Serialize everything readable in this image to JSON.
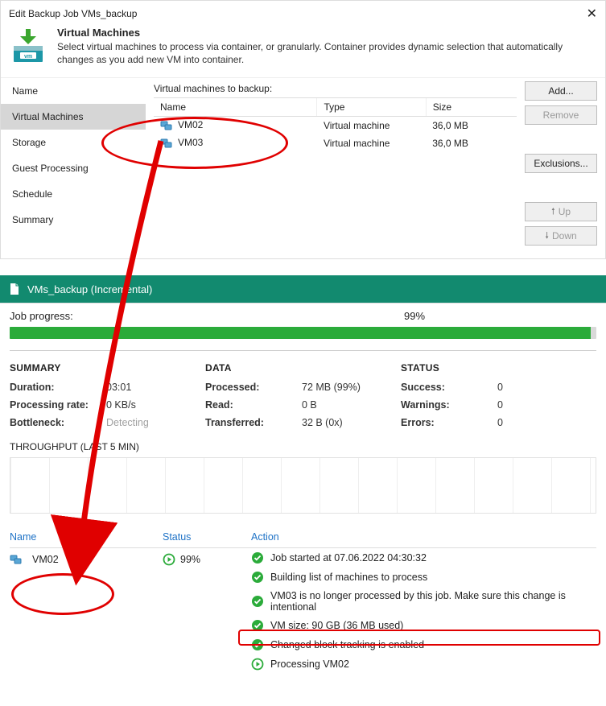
{
  "dialog": {
    "title": "Edit Backup Job VMs_backup",
    "banner": {
      "heading": "Virtual Machines",
      "desc": "Select virtual machines to process via container, or granularly. Container provides dynamic selection that automatically changes as you add new VM into container."
    },
    "sidebar": [
      {
        "label": "Name",
        "selected": false
      },
      {
        "label": "Virtual Machines",
        "selected": true
      },
      {
        "label": "Storage",
        "selected": false
      },
      {
        "label": "Guest Processing",
        "selected": false
      },
      {
        "label": "Schedule",
        "selected": false
      },
      {
        "label": "Summary",
        "selected": false
      }
    ],
    "section_label": "Virtual machines to backup:",
    "columns": [
      "Name",
      "Type",
      "Size"
    ],
    "rows": [
      {
        "name": "VM02",
        "type": "Virtual machine",
        "size": "36,0 MB"
      },
      {
        "name": "VM03",
        "type": "Virtual machine",
        "size": "36,0 MB"
      }
    ],
    "buttons": {
      "add": "Add...",
      "remove": "Remove",
      "exclusions": "Exclusions...",
      "up": "Up",
      "down": "Down"
    }
  },
  "job": {
    "title": "VMs_backup (Incremental)",
    "progress_label": "Job progress:",
    "progress_value": "99%",
    "progress_percent": 99,
    "summary": {
      "head": "SUMMARY",
      "duration_k": "Duration:",
      "duration_v": "03:01",
      "rate_k": "Processing rate:",
      "rate_v": "0 KB/s",
      "bottleneck_k": "Bottleneck:",
      "bottleneck_v": "Detecting"
    },
    "data": {
      "head": "DATA",
      "processed_k": "Processed:",
      "processed_v": "72 MB (99%)",
      "read_k": "Read:",
      "read_v": "0 B",
      "transferred_k": "Transferred:",
      "transferred_v": "32 B (0x)"
    },
    "status": {
      "head": "STATUS",
      "success_k": "Success:",
      "success_v": "0",
      "warnings_k": "Warnings:",
      "warnings_v": "0",
      "errors_k": "Errors:",
      "errors_v": "0"
    },
    "throughput_label": "THROUGHPUT (LAST 5 MIN)",
    "lower": {
      "name_head": "Name",
      "status_head": "Status",
      "action_head": "Action",
      "vm_name": "VM02",
      "vm_status": "99%",
      "actions": [
        "Job started at 07.06.2022 04:30:32",
        "Building list of machines to process",
        "VM03 is no longer processed by this job. Make sure this change is intentional",
        "VM size: 90 GB (36 MB used)",
        "Changed block tracking is enabled",
        "Processing VM02"
      ]
    }
  }
}
